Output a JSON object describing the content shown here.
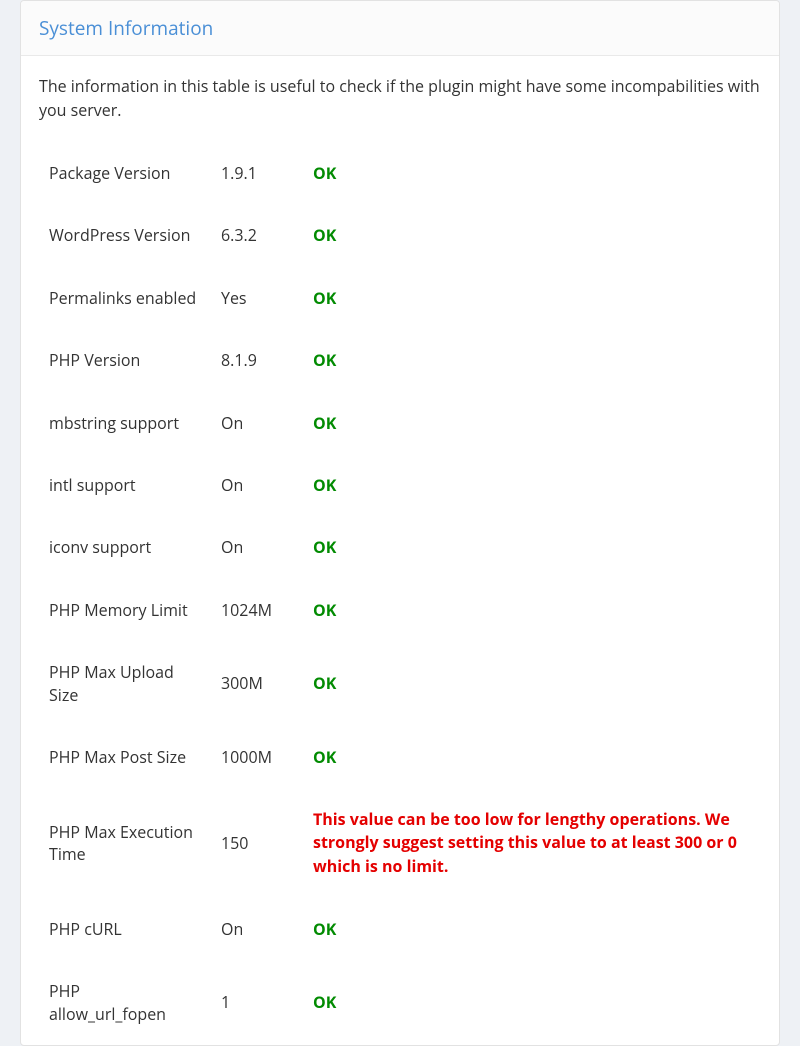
{
  "panel": {
    "title": "System Information",
    "description": "The information in this table is useful to check if the plugin might have some incompabilities with you server."
  },
  "rows": [
    {
      "label": "Package Version",
      "value": "1.9.1",
      "status": "OK",
      "statusClass": "status-ok"
    },
    {
      "label": "WordPress Version",
      "value": "6.3.2",
      "status": "OK",
      "statusClass": "status-ok"
    },
    {
      "label": "Permalinks enabled",
      "value": "Yes",
      "status": "OK",
      "statusClass": "status-ok"
    },
    {
      "label": "PHP Version",
      "value": "8.1.9",
      "status": "OK",
      "statusClass": "status-ok"
    },
    {
      "label": "mbstring support",
      "value": "On",
      "status": "OK",
      "statusClass": "status-ok"
    },
    {
      "label": "intl support",
      "value": "On",
      "status": "OK",
      "statusClass": "status-ok"
    },
    {
      "label": "iconv support",
      "value": "On",
      "status": "OK",
      "statusClass": "status-ok"
    },
    {
      "label": "PHP Memory Limit",
      "value": "1024M",
      "status": "OK",
      "statusClass": "status-ok"
    },
    {
      "label": "PHP Max Upload Size",
      "value": "300M",
      "status": "OK",
      "statusClass": "status-ok"
    },
    {
      "label": "PHP Max Post Size",
      "value": "1000M",
      "status": "OK",
      "statusClass": "status-ok"
    },
    {
      "label": "PHP Max Execution Time",
      "value": "150",
      "status": "This value can be too low for lengthy operations. We strongly suggest setting this value to at least 300 or 0 which is no limit.",
      "statusClass": "status-warn"
    },
    {
      "label": "PHP cURL",
      "value": "On",
      "status": "OK",
      "statusClass": "status-ok"
    },
    {
      "label": "PHP allow_url_fopen",
      "value": "1",
      "status": "OK",
      "statusClass": "status-ok"
    }
  ]
}
